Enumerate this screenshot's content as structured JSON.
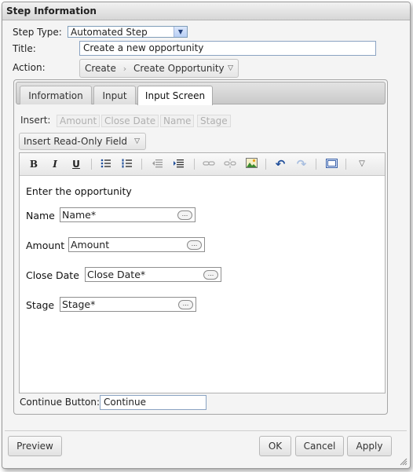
{
  "dialog": {
    "title": "Step Information"
  },
  "form": {
    "step_type_label": "Step Type:",
    "step_type_value": "Automated Step",
    "title_label": "Title:",
    "title_value": "Create a new opportunity",
    "action_label": "Action:",
    "action_part1": "Create",
    "action_separator": "›",
    "action_part2": "Create Opportunity"
  },
  "tabs": [
    {
      "label": "Information",
      "active": false
    },
    {
      "label": "Input",
      "active": false
    },
    {
      "label": "Input Screen",
      "active": true
    }
  ],
  "insert": {
    "label": "Insert:",
    "fields": [
      "Amount",
      "Close Date",
      "Name",
      "Stage"
    ],
    "readonly_button": "Insert Read-Only Field"
  },
  "toolbar": {
    "bold": "B",
    "italic": "I",
    "underline": "U",
    "icons": [
      "bold-icon",
      "italic-icon",
      "underline-icon",
      "bullet-list-icon",
      "numbered-list-icon",
      "outdent-icon",
      "indent-icon",
      "link-icon",
      "unlink-icon",
      "image-icon",
      "undo-icon",
      "redo-icon",
      "source-icon",
      "more-icon"
    ]
  },
  "editor": {
    "heading": "Enter the opportunity",
    "fields": [
      {
        "label": "Name",
        "value": "Name*"
      },
      {
        "label": "Amount",
        "value": "Amount"
      },
      {
        "label": "Close Date",
        "value": "Close Date*"
      },
      {
        "label": "Stage",
        "value": "Stage*"
      }
    ],
    "ellipsis": "..."
  },
  "continue": {
    "label": "Continue Button:",
    "value": "Continue"
  },
  "buttons": {
    "preview": "Preview",
    "ok": "OK",
    "cancel": "Cancel",
    "apply": "Apply"
  }
}
